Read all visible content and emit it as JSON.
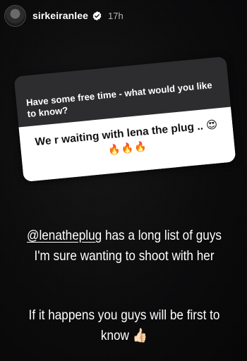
{
  "header": {
    "username": "sirkeiranlee",
    "time": "17h"
  },
  "sticker": {
    "question": "Have some free time - what would you like to know?",
    "answer": "We r waiting with lena the plug ..",
    "answer_emojis": "😍",
    "flames": "🔥🔥🔥"
  },
  "caption": {
    "mention": "@lenatheplug",
    "line1_rest": " has a long list of guys I'm sure wanting to shoot with her",
    "line2": "If it happens you guys will be first to know",
    "line2_emoji": "👍🏻"
  },
  "colors": {
    "background": "#0b0b0c",
    "sticker_top": "#2d2d2f",
    "sticker_bottom": "#ffffff"
  }
}
